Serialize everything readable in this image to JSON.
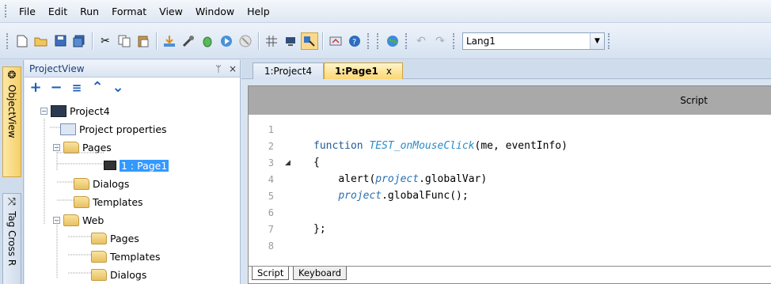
{
  "menu": [
    "File",
    "Edit",
    "Run",
    "Format",
    "View",
    "Window",
    "Help"
  ],
  "toolbar": {
    "icons": [
      "new-icon",
      "open-icon",
      "save-icon",
      "save-all-icon",
      "cut-icon",
      "copy-icon",
      "paste-icon",
      "download-icon",
      "build-icon",
      "debug-icon",
      "run-icon",
      "stop-icon",
      "grid-icon",
      "align-icon",
      "snap-icon",
      "settings-icon",
      "help-icon",
      "globe-icon",
      "undo-icon",
      "redo-icon"
    ],
    "language": "Lang1"
  },
  "left_strip": {
    "tab1": "ObjectView",
    "tab2": "Tag Cross R"
  },
  "project_view": {
    "title": "ProjectView",
    "pin": "ᛘ",
    "close": "×",
    "tools": [
      "+",
      "−",
      "≡",
      "⌃",
      "⌄"
    ],
    "tree": [
      {
        "label": "Project4",
        "icon": "monitor"
      },
      {
        "label": "Project properties",
        "icon": "props"
      },
      {
        "label": "Pages",
        "icon": "folder"
      },
      {
        "label": "1 : Page1",
        "icon": "page"
      },
      {
        "label": "Dialogs",
        "icon": "folder"
      },
      {
        "label": "Templates",
        "icon": "folder"
      },
      {
        "label": "Web",
        "icon": "folder"
      },
      {
        "label": "Pages",
        "icon": "folder"
      },
      {
        "label": "Templates",
        "icon": "folder"
      },
      {
        "label": "Dialogs",
        "icon": "folder"
      }
    ]
  },
  "doc_tabs": [
    {
      "label": "1:Project4"
    },
    {
      "label": "1:Page1",
      "close": "x"
    }
  ],
  "editor": {
    "header": "Script",
    "line_numbers": [
      "1",
      "2",
      "3",
      "4",
      "5",
      "6",
      "7",
      "8"
    ],
    "code": {
      "l2_kw": "function",
      "l2_fn": "TEST_onMouseClick",
      "l2_rest": "(me, eventInfo)",
      "l3": "{",
      "l4_a": "alert(",
      "l4_obj": "project",
      "l4_b": ".globalVar)",
      "l5_obj": "project",
      "l5_b": ".globalFunc();",
      "l7": "};"
    },
    "bottom_tabs": [
      "Script",
      "Keyboard"
    ]
  },
  "colors": {
    "accent_selected": "#3399ff",
    "active_tab": "#fbd774"
  }
}
